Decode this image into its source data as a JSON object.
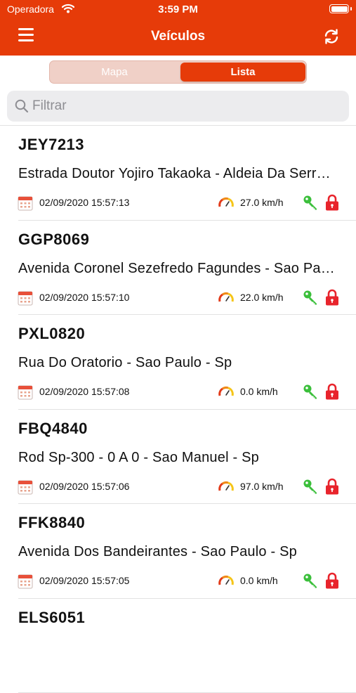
{
  "status_bar": {
    "carrier": "Operadora",
    "time": "3:59 PM"
  },
  "header": {
    "title": "Veículos"
  },
  "segments": {
    "map": "Mapa",
    "list": "Lista",
    "selected": "Lista"
  },
  "search": {
    "placeholder": "Filtrar",
    "value": ""
  },
  "colors": {
    "brand": "#e63b09",
    "key": "#3bbf3b",
    "lock": "#e8242c"
  },
  "vehicles": [
    {
      "plate": "JEY7213",
      "address": "Estrada Doutor Yojiro Takaoka - Aldeia Da Serra - Santana De Parnaiba - Sp",
      "datetime": "02/09/2020 15:57:13",
      "speed": "27.0 km/h"
    },
    {
      "plate": "GGP8069",
      "address": "Avenida Coronel Sezefredo Fagundes - Sao Paulo - Sp",
      "datetime": "02/09/2020 15:57:10",
      "speed": "22.0 km/h"
    },
    {
      "plate": "PXL0820",
      "address": "Rua Do Oratorio - Sao Paulo - Sp",
      "datetime": "02/09/2020 15:57:08",
      "speed": "0.0 km/h"
    },
    {
      "plate": "FBQ4840",
      "address": "Rod Sp-300 - 0 A 0 - Sao Manuel - Sp",
      "datetime": "02/09/2020 15:57:06",
      "speed": "97.0 km/h"
    },
    {
      "plate": "FFK8840",
      "address": "Avenida Dos Bandeirantes - Sao Paulo - Sp",
      "datetime": "02/09/2020 15:57:05",
      "speed": "0.0 km/h"
    },
    {
      "plate": "ELS6051",
      "address": "",
      "datetime": "",
      "speed": ""
    }
  ]
}
